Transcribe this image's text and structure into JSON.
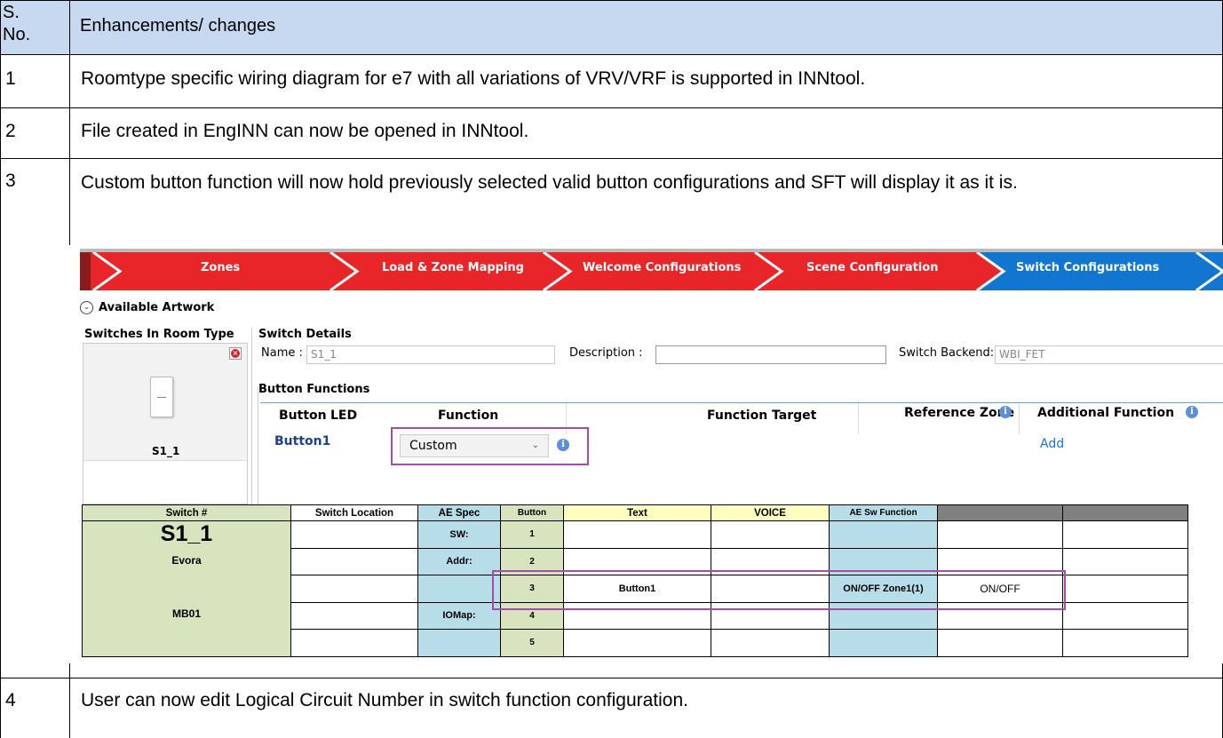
{
  "table": {
    "header": {
      "sno": "S. No.",
      "changes": "Enhancements/ changes"
    },
    "rows": [
      {
        "no": "1",
        "text": "Roomtype specific wiring diagram for e7 with all variations of VRV/VRF is supported in INNtool."
      },
      {
        "no": "2",
        "text": "File created in EngINN can now be opened in INNtool."
      },
      {
        "no": "3",
        "text": "Custom button function will now hold previously selected valid button configurations and SFT will display it as it is."
      },
      {
        "no": "4",
        "text": "User can now edit Logical Circuit Number in switch function configuration."
      }
    ]
  },
  "screenshot": {
    "nav": [
      "Zones",
      "Load & Zone Mapping",
      "Welcome Configurations",
      "Scene  Configuration",
      "Switch Configurations"
    ],
    "available_artwork": "Available Artwork",
    "switches_in_room_type": "Switches In Room Type",
    "switch_tile_label": "S1_1",
    "switch_details": "Switch Details",
    "name_label": "Name :",
    "name_value": "S1_1",
    "description_label": "Description :",
    "description_value": "",
    "backend_label": "Switch Backend:",
    "backend_value": "WBI_FET",
    "button_functions": "Button Functions",
    "col_button": "Button",
    "col_led": "LED",
    "col_function": "Function",
    "col_function_target": "Function Target",
    "col_reference_zone": "Reference Zone",
    "col_additional_function": "Additional Function",
    "row_button": "Button1",
    "function_value": "Custom",
    "add_link": "Add",
    "grid": {
      "headers": [
        "Switch #",
        "Switch Location",
        "AE Spec",
        "Button",
        "Text",
        "VOICE",
        "AE Sw Function",
        "",
        ""
      ],
      "switch_name": "S1_1",
      "switch_model": "Evora",
      "switch_board": "MB01",
      "ae_spec": [
        "SW:",
        "Addr:",
        "",
        "IOMap:",
        ""
      ],
      "buttons": [
        "1",
        "2",
        "3",
        "4",
        "5"
      ],
      "row3_text": "Button1",
      "row3_aefunc": "ON/OFF Zone1(1)",
      "row3_extra": "ON/OFF"
    },
    "colors": {
      "nav_red": "#e8262a",
      "nav_blue": "#1275d0",
      "highlight": "#a64ca6",
      "header_blue": "#c6d9f1"
    }
  }
}
